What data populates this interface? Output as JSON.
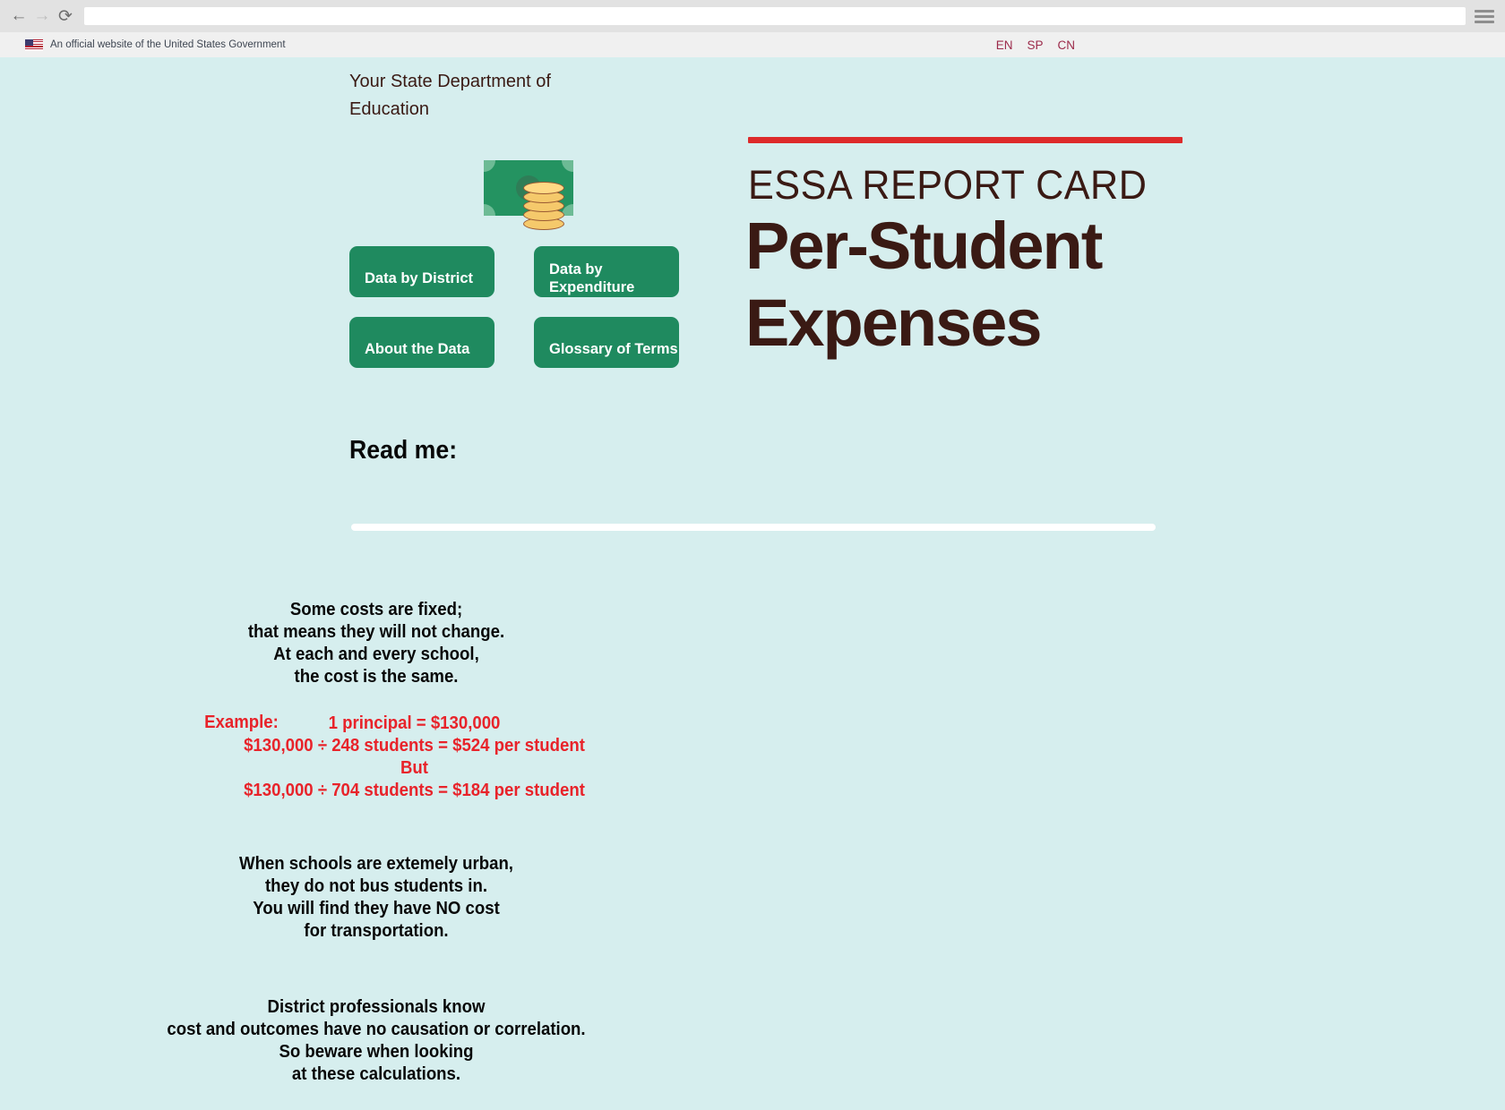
{
  "browser": {
    "back_icon": "←",
    "forward_icon": "→",
    "reload_icon": "⟳",
    "menu_icon": "hamburger-menu-icon",
    "url_value": "",
    "url_placeholder": ""
  },
  "gov_banner": {
    "flag_icon": "us-flag-icon",
    "text": "An official website of the United States Government",
    "languages": [
      {
        "code": "EN"
      },
      {
        "code": "SP"
      },
      {
        "code": "CN"
      }
    ]
  },
  "site": {
    "title": "Your State Department of Education"
  },
  "money_icon": {
    "name": "money-with-coins-icon",
    "bill_color": "#249361",
    "coin_color": "#f5c96b"
  },
  "nav_buttons": [
    {
      "label": "Data by District"
    },
    {
      "label": "Data by Expenditure"
    },
    {
      "label": "About the Data"
    },
    {
      "label": "Glossary of Terms"
    }
  ],
  "hero": {
    "rule_color": "#dd2a2a",
    "kicker": "ESSA REPORT CARD",
    "title_line1": "Per-Student",
    "title_line2": "Expenses",
    "title_color": "#3a1a14"
  },
  "read_me": {
    "heading": "Read me:",
    "rule_color": "#ffffff",
    "stanza_1": [
      "Some costs are fixed;",
      "that means they will not change.",
      "At each and every school,",
      "the cost is the same."
    ],
    "example_label": "Example:",
    "example_color": "#e8232a",
    "example_lines": [
      "1 principal = $130,000",
      "$130,000 ÷ 248 students = $524 per student",
      "But",
      "$130,000 ÷ 704 students = $184 per student"
    ],
    "stanza_2": [
      "When schools are extemely urban,",
      "they do not bus students in.",
      "You will find they have NO cost",
      "for transportation."
    ],
    "stanza_3": [
      "District professionals know",
      "cost and outcomes have no causation or correlation.",
      "So beware when looking",
      "at these calculations."
    ]
  },
  "theme": {
    "page_background": "#d6eeee",
    "button_green": "#1f8a5f",
    "accent_red": "#e8232a",
    "link_maroon": "#9c2a4a"
  }
}
